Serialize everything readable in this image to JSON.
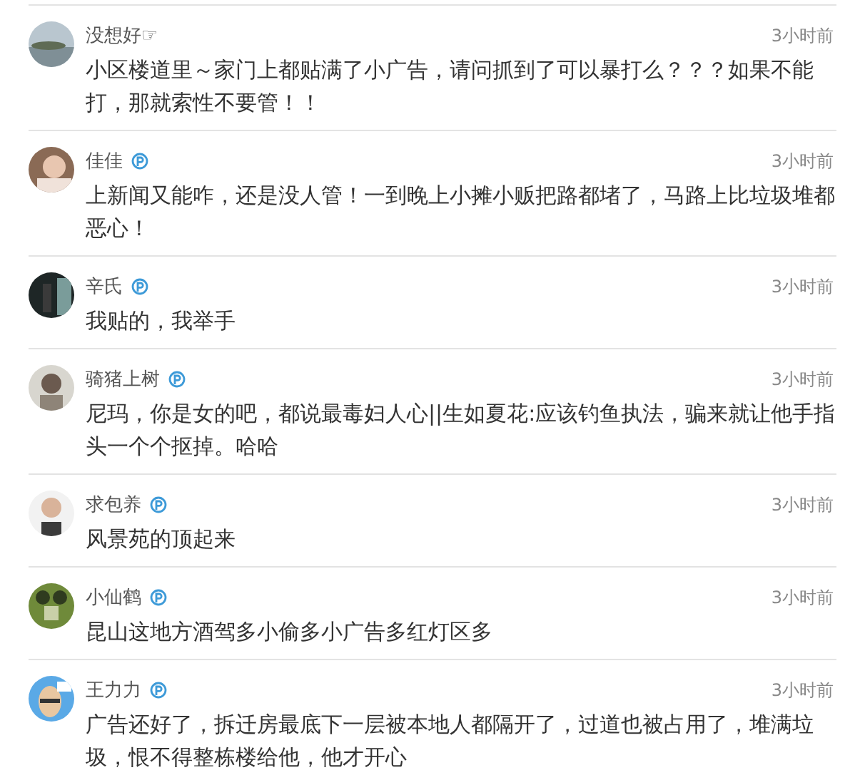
{
  "comments": [
    {
      "author": "没想好☞",
      "verified": false,
      "time": "3小时前",
      "text": "小区楼道里～家门上都贴满了小广告，请问抓到了可以暴打么？？？如果不能打，那就索性不要管！！"
    },
    {
      "author": "佳佳",
      "verified": true,
      "time": "3小时前",
      "text": "上新闻又能咋，还是没人管！一到晚上小摊小贩把路都堵了，马路上比垃圾堆都恶心！"
    },
    {
      "author": "辛氏",
      "verified": true,
      "time": "3小时前",
      "text": "我贴的，我举手"
    },
    {
      "author": "骑猪上树",
      "verified": true,
      "time": "3小时前",
      "text": "尼玛，你是女的吧，都说最毒妇人心||生如夏花:应该钓鱼执法，骗来就让他手指头一个个抠掉。哈哈"
    },
    {
      "author": "求包养",
      "verified": true,
      "time": "3小时前",
      "text": "风景苑的顶起来"
    },
    {
      "author": "小仙鹤",
      "verified": true,
      "time": "3小时前",
      "text": "昆山这地方酒驾多小偷多小广告多红灯区多"
    },
    {
      "author": "王力力",
      "verified": true,
      "time": "3小时前",
      "text": "广告还好了，拆迁房最底下一层被本地人都隔开了，过道也被占用了，堆满垃圾，恨不得整栋楼给他，他才开心"
    }
  ]
}
